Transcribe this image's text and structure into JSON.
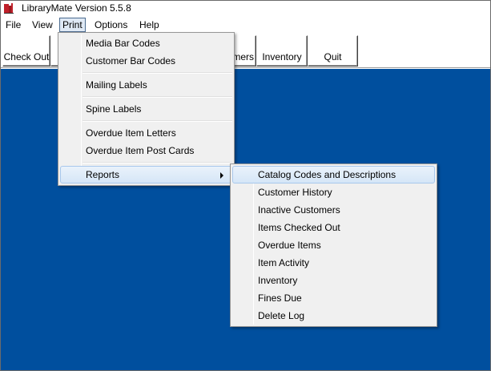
{
  "app": {
    "title": "LibraryMate Version 5.5.8",
    "icon": "library-app-icon"
  },
  "menubar": {
    "items": [
      {
        "label": "File"
      },
      {
        "label": "View"
      },
      {
        "label": "Print"
      },
      {
        "label": "Options"
      },
      {
        "label": "Help"
      }
    ]
  },
  "toolbar": {
    "buttons": [
      {
        "label": "Check Out"
      },
      {
        "label": "mers"
      },
      {
        "label": "Inventory"
      },
      {
        "label": "Quit"
      }
    ]
  },
  "print_menu": {
    "items": [
      {
        "label": "Media Bar Codes"
      },
      {
        "label": "Customer Bar Codes"
      },
      {
        "label": "Mailing Labels"
      },
      {
        "label": "Spine Labels"
      },
      {
        "label": "Overdue Item Letters"
      },
      {
        "label": "Overdue Item Post Cards"
      },
      {
        "label": "Reports"
      }
    ]
  },
  "reports_menu": {
    "items": [
      {
        "label": "Catalog Codes and Descriptions"
      },
      {
        "label": "Customer History"
      },
      {
        "label": "Inactive Customers"
      },
      {
        "label": "Items Checked Out"
      },
      {
        "label": "Overdue Items"
      },
      {
        "label": "Item Activity"
      },
      {
        "label": "Inventory"
      },
      {
        "label": "Fines Due"
      },
      {
        "label": "Delete Log"
      }
    ]
  },
  "colors": {
    "workspace": "#004f9e",
    "menu_background": "#f0f0f0",
    "highlight": "#d5e6f7"
  }
}
